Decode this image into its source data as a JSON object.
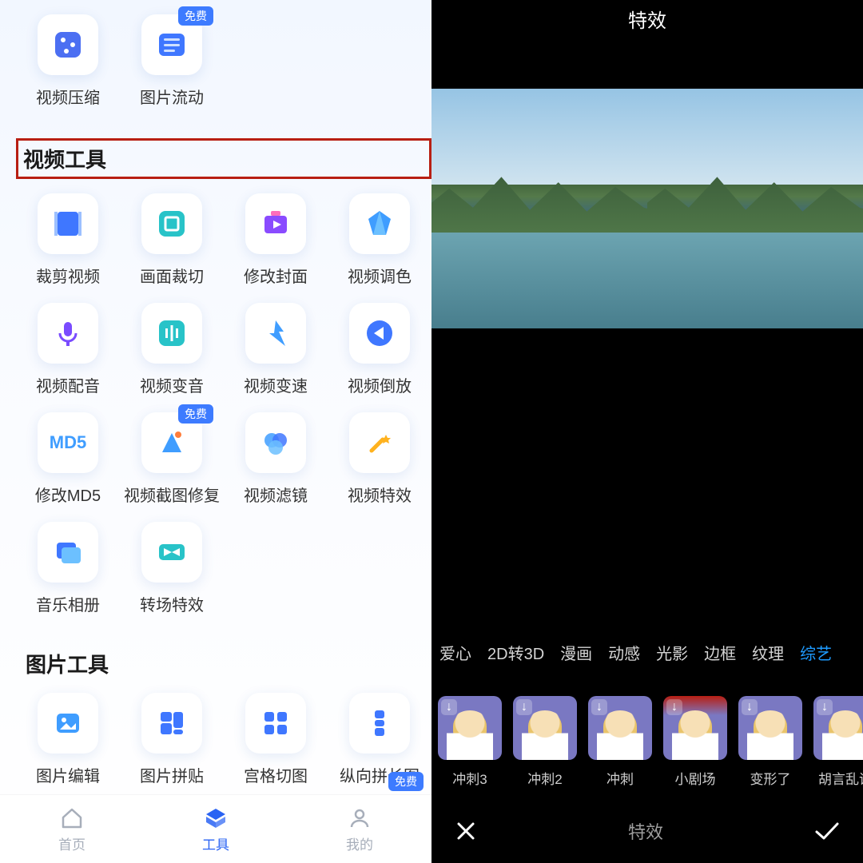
{
  "left": {
    "badges": {
      "free": "免费"
    },
    "top_row": [
      {
        "id": "video-compress",
        "label": "视频压缩",
        "badge": null
      },
      {
        "id": "image-flow",
        "label": "图片流动",
        "badge": "free"
      }
    ],
    "highlight_section": "视频工具",
    "video_tools": [
      {
        "id": "crop-video",
        "label": "裁剪视频"
      },
      {
        "id": "frame-crop",
        "label": "画面裁切"
      },
      {
        "id": "edit-cover",
        "label": "修改封面"
      },
      {
        "id": "video-color",
        "label": "视频调色"
      },
      {
        "id": "video-dub",
        "label": "视频配音"
      },
      {
        "id": "voice-change",
        "label": "视频变音"
      },
      {
        "id": "speed-change",
        "label": "视频变速"
      },
      {
        "id": "video-reverse",
        "label": "视频倒放"
      },
      {
        "id": "edit-md5",
        "label": "修改MD5"
      },
      {
        "id": "screenshot-fix",
        "label": "视频截图修复",
        "badge": "free"
      },
      {
        "id": "video-filter",
        "label": "视频滤镜"
      },
      {
        "id": "video-effect",
        "label": "视频特效"
      },
      {
        "id": "music-album",
        "label": "音乐相册"
      },
      {
        "id": "transition-fx",
        "label": "转场特效"
      }
    ],
    "image_section": "图片工具",
    "image_tools": [
      {
        "id": "image-edit",
        "label": "图片编辑"
      },
      {
        "id": "image-collage",
        "label": "图片拼贴"
      },
      {
        "id": "grid-cut",
        "label": "宫格切图"
      },
      {
        "id": "vertical-long",
        "label": "纵向拼长图"
      }
    ],
    "bottom_nav": [
      {
        "id": "home",
        "label": "首页"
      },
      {
        "id": "tools",
        "label": "工具",
        "active": true
      },
      {
        "id": "mine",
        "label": "我的"
      }
    ],
    "floating_badge": "免费"
  },
  "right": {
    "title": "特效",
    "categories": [
      {
        "id": "heart",
        "label": "爱心"
      },
      {
        "id": "2d3d",
        "label": "2D转3D"
      },
      {
        "id": "comic",
        "label": "漫画"
      },
      {
        "id": "dynamic",
        "label": "动感"
      },
      {
        "id": "light",
        "label": "光影"
      },
      {
        "id": "frame",
        "label": "边框"
      },
      {
        "id": "texture",
        "label": "纹理"
      },
      {
        "id": "variety",
        "label": "综艺",
        "active": true
      }
    ],
    "effects": [
      {
        "id": "sprint3",
        "label": "冲刺3"
      },
      {
        "id": "sprint2",
        "label": "冲刺2"
      },
      {
        "id": "sprint",
        "label": "冲刺"
      },
      {
        "id": "theatre",
        "label": "小剧场",
        "variant": "theatre"
      },
      {
        "id": "deformed",
        "label": "变形了"
      },
      {
        "id": "nonsense",
        "label": "胡言乱语"
      }
    ],
    "bottom": {
      "cancel": "close-icon",
      "label": "特效",
      "confirm": "check-icon"
    }
  }
}
